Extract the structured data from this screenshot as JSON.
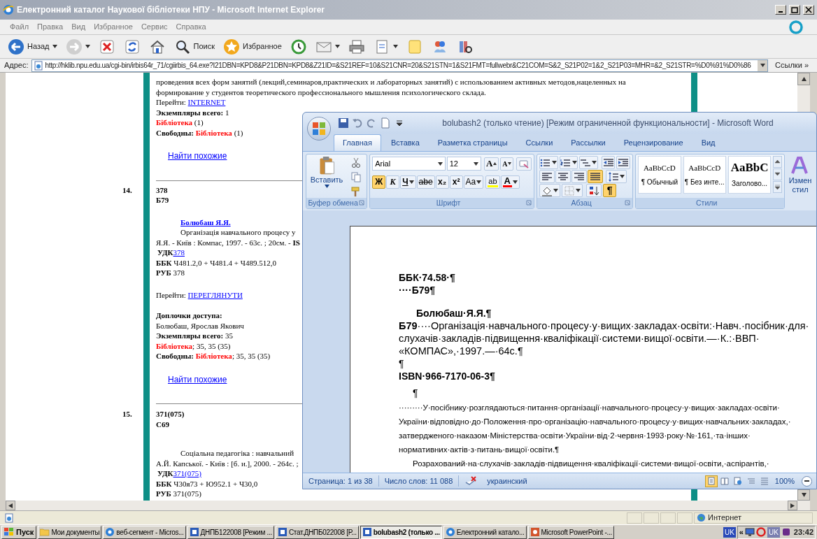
{
  "ie": {
    "title": "Електронний каталог Наукової бібліотеки НПУ - Microsoft Internet Explorer",
    "menu": [
      "Файл",
      "Правка",
      "Вид",
      "Избранное",
      "Сервис",
      "Справка"
    ],
    "toolbar": [
      {
        "kind": "back",
        "label": "Назад",
        "dropdown": true
      },
      {
        "kind": "forward",
        "dropdown": true
      },
      {
        "kind": "stop",
        "dropdown": false
      },
      {
        "kind": "refresh",
        "dropdown": false
      },
      {
        "kind": "home",
        "dropdown": false
      },
      {
        "kind": "search",
        "label": "Поиск",
        "dropdown": false
      },
      {
        "kind": "favorites",
        "label": "Избранное",
        "dropdown": false
      },
      {
        "kind": "history",
        "dropdown": false
      },
      {
        "kind": "mail",
        "dropdown": true
      },
      {
        "kind": "print",
        "dropdown": false
      },
      {
        "kind": "edit",
        "dropdown": true
      },
      {
        "kind": "note",
        "dropdown": false
      },
      {
        "kind": "messenger",
        "dropdown": false
      },
      {
        "kind": "research",
        "dropdown": false
      }
    ],
    "address_label": "Адрес:",
    "url": "http://hklib.npu.edu.ua/cgi-bin/irbis64r_71/cgiirbis_64.exe?I21DBN=KPD8&P21DBN=KPD8&Z21ID=&S21REF=10&S21CNR=20&S21STN=1&S21FMT=fullwebr&C21COM=S&2_S21P02=1&2_S21P03=MHR=&2_S21STR=%D0%91%D0%86",
    "links": "Ссылки",
    "links_more": "»",
    "status": "Интернет"
  },
  "catalog": {
    "records": [
      {
        "lines": [
          {
            "kind": "plain",
            "segments": [
              {
                "kind": "plain",
                "text": "проведения всех форм занятий (лекций,семинаров,практических и лабораторных занятий) с использованием активных методов,нацеленных на"
              }
            ]
          },
          {
            "kind": "plain",
            "segments": [
              {
                "kind": "plain",
                "text": "формирование у студентов теоретического профессионального мышления психологического склада."
              }
            ]
          },
          {
            "kind": "plain",
            "segments": [
              {
                "kind": "plain",
                "text": "Перейти: "
              },
              {
                "kind": "link",
                "text": "INTERNET"
              }
            ]
          },
          {
            "kind": "plain",
            "segments": [
              {
                "kind": "bold",
                "text": "Экземпляры всего: "
              },
              {
                "kind": "plain",
                "text": "1"
              }
            ]
          },
          {
            "kind": "plain",
            "segments": [
              {
                "kind": "red",
                "text": "Бібліотека"
              },
              {
                "kind": "plain",
                "text": " (1)"
              }
            ]
          },
          {
            "kind": "plain",
            "segments": [
              {
                "kind": "bold",
                "text": "Свободны: "
              },
              {
                "kind": "red",
                "text": "Бібліотека"
              },
              {
                "kind": "plain",
                "text": " (1)"
              }
            ]
          }
        ],
        "similar": "Найти похожие"
      },
      {
        "number": "14.",
        "codes": [
          "378",
          "Б79"
        ],
        "lines": [
          {
            "kind": "author",
            "segments": [
              {
                "kind": "bold-link",
                "text": "Болюбаш Я.Я."
              }
            ]
          },
          {
            "kind": "title",
            "segments": [
              {
                "kind": "plain",
                "text": "Організація навчального процесу у"
              }
            ]
          },
          {
            "kind": "plain",
            "segments": [
              {
                "kind": "plain",
                "text": "Я.Я. - Київ : Компас, 1997. - 63с. ; 20см. - "
              },
              {
                "kind": "bold",
                "text": "IS"
              }
            ]
          },
          {
            "kind": "udk",
            "segments": [
              {
                "kind": "bold",
                "text": "УДК"
              },
              {
                "kind": "link",
                "text": "378"
              }
            ]
          },
          {
            "kind": "plain",
            "segments": [
              {
                "kind": "bold",
                "text": "ББК "
              },
              {
                "kind": "plain",
                "text": "Ч481.2,0 + Ч481.4 + Ч489.512,0"
              }
            ]
          },
          {
            "kind": "plain",
            "segments": [
              {
                "kind": "bold",
                "text": "РУБ "
              },
              {
                "kind": "plain",
                "text": "378"
              }
            ]
          },
          {
            "kind": "goto",
            "segments": [
              {
                "kind": "plain",
                "text": "Перейти: "
              },
              {
                "kind": "link",
                "text": "ПЕРЕГЛЯНУТИ"
              }
            ]
          },
          {
            "kind": "label",
            "segments": [
              {
                "kind": "bold",
                "text": "Доплочки доступа:"
              }
            ]
          },
          {
            "kind": "plain",
            "segments": [
              {
                "kind": "plain",
                "text": "Болюбаш, Ярослав Якович"
              }
            ]
          },
          {
            "kind": "plain",
            "segments": [
              {
                "kind": "bold",
                "text": "Экземпляры всего: "
              },
              {
                "kind": "plain",
                "text": "35"
              }
            ]
          },
          {
            "kind": "plain",
            "segments": [
              {
                "kind": "red",
                "text": "Бібліотека"
              },
              {
                "kind": "plain",
                "text": "; 35, 35 (35)"
              }
            ]
          },
          {
            "kind": "plain",
            "segments": [
              {
                "kind": "bold",
                "text": "Свободны: "
              },
              {
                "kind": "red",
                "text": "Бібліотека"
              },
              {
                "kind": "plain",
                "text": "; 35, 35 (35)"
              }
            ]
          }
        ],
        "similar": "Найти похожие"
      },
      {
        "number": "15.",
        "codes": [
          "371(075)",
          "С69"
        ],
        "lines": [
          {
            "kind": "title",
            "segments": [
              {
                "kind": "plain",
                "text": "Соціальна педагогіка : навчальний"
              }
            ]
          },
          {
            "kind": "plain",
            "segments": [
              {
                "kind": "plain",
                "text": "А.Й. Капської. - Київ : [б. и.], 2000. - 264с. ;"
              }
            ]
          },
          {
            "kind": "udk",
            "segments": [
              {
                "kind": "bold",
                "text": "УДК"
              },
              {
                "kind": "link",
                "text": "371(075)"
              }
            ]
          },
          {
            "kind": "plain",
            "segments": [
              {
                "kind": "bold",
                "text": "ББК "
              },
              {
                "kind": "plain",
                "text": "Ч30я73 + Ю952.1 + Ч30,0"
              }
            ]
          },
          {
            "kind": "plain",
            "segments": [
              {
                "kind": "bold",
                "text": "РУБ "
              },
              {
                "kind": "plain",
                "text": "371(075)"
              }
            ]
          }
        ]
      }
    ]
  },
  "word": {
    "title": "bolubash2 (только чтение) [Режим ограниченной функциональности] - Microsoft Word",
    "quick_access": [
      {
        "kind": "save"
      },
      {
        "kind": "undo"
      },
      {
        "kind": "redo"
      },
      {
        "kind": "new"
      },
      {
        "kind": "customize"
      }
    ],
    "tabs": [
      {
        "label": "Главная",
        "selected": true
      },
      {
        "label": "Вставка",
        "selected": false
      },
      {
        "label": "Разметка страницы",
        "selected": false
      },
      {
        "label": "Ссылки",
        "selected": false
      },
      {
        "label": "Рассылки",
        "selected": false
      },
      {
        "label": "Рецензирование",
        "selected": false
      },
      {
        "label": "Вид",
        "selected": false
      }
    ],
    "clipboard": {
      "label": "Буфер обмена",
      "paste": "Вставить"
    },
    "font": {
      "label": "Шрифт",
      "name": "Arial",
      "size": "12",
      "grow": "A",
      "shrink": "A",
      "buttons": [
        {
          "text": "Ж",
          "kind": "bold",
          "on": true,
          "dropdown": false
        },
        {
          "text": "К",
          "kind": "italic",
          "on": false,
          "dropdown": false
        },
        {
          "text": "Ч",
          "kind": "underline",
          "on": false,
          "dropdown": true
        },
        {
          "text": "abe",
          "kind": "strike",
          "on": false,
          "dropdown": false
        },
        {
          "text": "x₂",
          "kind": "sub",
          "on": false,
          "dropdown": false
        },
        {
          "text": "x²",
          "kind": "super",
          "on": false,
          "dropdown": false
        },
        {
          "text": "Aa",
          "kind": "case",
          "on": false,
          "dropdown": true
        }
      ],
      "highlight": "ab",
      "color_letter": "A"
    },
    "paragraph": {
      "label": "Абзац",
      "align": [
        {
          "kind": "left",
          "on": false
        },
        {
          "kind": "center",
          "on": false
        },
        {
          "kind": "right",
          "on": false
        },
        {
          "kind": "justify",
          "on": true
        }
      ],
      "marks_symbol": "¶",
      "marks_on": true
    },
    "styles": {
      "label": "Стили",
      "items": [
        {
          "sample": "AaBbCcD",
          "name": "¶ Обычный",
          "kind": "body"
        },
        {
          "sample": "AaBbCcD",
          "name": "¶ Без инте...",
          "kind": "body"
        },
        {
          "sample": "AaBbC",
          "name": "Заголово...",
          "kind": "heading"
        }
      ]
    },
    "change_styles": [
      "Измен",
      "стил"
    ],
    "document": {
      "lines": [
        {
          "kind": "heading",
          "text": "ББК·74.58·¶"
        },
        {
          "kind": "heading",
          "text": "····Б79¶"
        },
        {
          "kind": "author",
          "text": "Болюбаш·Я.Я.¶"
        },
        {
          "kind": "body",
          "text": "**Б79**····Організація·навчального·процесу·у·вищих·закладах·освіти:·Навч.·посібник·для·"
        },
        {
          "kind": "body",
          "text": "слухачів·закладів·підвищення·кваліфікації·системи·вищої·освіти.—·К.:·ВВП·"
        },
        {
          "kind": "body",
          "text": "«КОМПАС»,·1997.—·64с.¶"
        },
        {
          "kind": "mark",
          "text": "¶"
        },
        {
          "kind": "heading",
          "text": "ISBN·966-7170-06-3¶"
        },
        {
          "kind": "indent-mark",
          "text": "¶"
        },
        {
          "kind": "small",
          "text": "·········У·посібнику·розглядаються·питання·організації·навчального·процесу·у·вищих·закладах·освіти·"
        },
        {
          "kind": "small",
          "text": "України·відповідно·до·Положення·про·організацію·навчального·процесу·у·вищих·навчальних·закладах,·"
        },
        {
          "kind": "small",
          "text": "затвердженого·наказом·Міністерства·освіти·України·від·2·червня·1993·року·№·161,·та·інших·"
        },
        {
          "kind": "small",
          "text": "нормативних·актів·з·питань·вищої·освіти.¶"
        },
        {
          "kind": "small-indent",
          "text": "Розрахований·на·слухачів·закладів·підвищення·кваліфікації·системи·вищої·освіти,·аспірантів,·"
        }
      ]
    },
    "status": {
      "page": "Страница: 1 из 38",
      "words": "Число слов: 11 088",
      "language": "украинский",
      "zoom": "100%",
      "views": [
        {
          "kind": "print",
          "selected": true
        },
        {
          "kind": "reading",
          "selected": false
        },
        {
          "kind": "web",
          "selected": false
        },
        {
          "kind": "outline",
          "selected": false
        },
        {
          "kind": "draft",
          "selected": false
        }
      ]
    }
  },
  "taskbar": {
    "start": "Пуск",
    "items": [
      {
        "kind": "folder",
        "label": "Мои документы",
        "selected": false
      },
      {
        "kind": "ie",
        "label": "веб-сегмент - Micros...",
        "selected": false
      },
      {
        "kind": "word",
        "label": "ДНПБ122008 [Режим ...",
        "selected": false
      },
      {
        "kind": "word",
        "label": "Стат.ДНПБ022008 [Р...",
        "selected": false
      },
      {
        "kind": "word",
        "label": "bolubash2 (только ...",
        "selected": true
      },
      {
        "kind": "ie",
        "label": "Електронний катало...",
        "selected": false
      },
      {
        "kind": "powerpoint",
        "label": "Microsoft PowerPoint -...",
        "selected": false
      }
    ],
    "language": "UK",
    "tray_toggle": "«",
    "tray_badge": "UK",
    "clock": "23:42"
  }
}
